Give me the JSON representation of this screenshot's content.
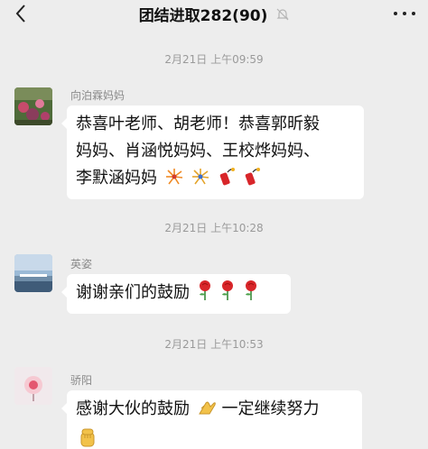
{
  "header": {
    "title": "团结进取282(90)",
    "back_icon": "chevron-left-icon",
    "mute_icon": "bell-muted-icon",
    "more_icon": "more-dots-icon"
  },
  "messages": [
    {
      "timestamp": "2月21日 上午09:59",
      "sender": "向泊霖妈妈",
      "lines": [
        "恭喜叶老师、胡老师！恭喜郭昕毅",
        "妈妈、肖涵悦妈妈、王校烨妈妈、",
        "李默涵妈妈"
      ],
      "emojis": [
        "fireworks-icon",
        "fireworks-icon",
        "firecracker-icon",
        "firecracker-icon"
      ]
    },
    {
      "timestamp": "2月21日 上午10:28",
      "sender": "英姿",
      "lines": [
        "谢谢亲们的鼓励"
      ],
      "emojis": [
        "rose-icon",
        "rose-icon",
        "rose-icon"
      ]
    },
    {
      "timestamp": "2月21日 上午10:53",
      "sender": "骄阳",
      "lines": [
        "感谢大伙的鼓励",
        "一定继续努力"
      ],
      "emojis": [
        "clapping-hands-icon",
        "raised-fist-icon"
      ]
    }
  ],
  "colors": {
    "background": "#ededed",
    "bubble": "#ffffff",
    "timestamp": "#9a9a9a",
    "name": "#8a8a8a",
    "rose_red": "#d8262a",
    "firework_orange": "#f08a24"
  }
}
